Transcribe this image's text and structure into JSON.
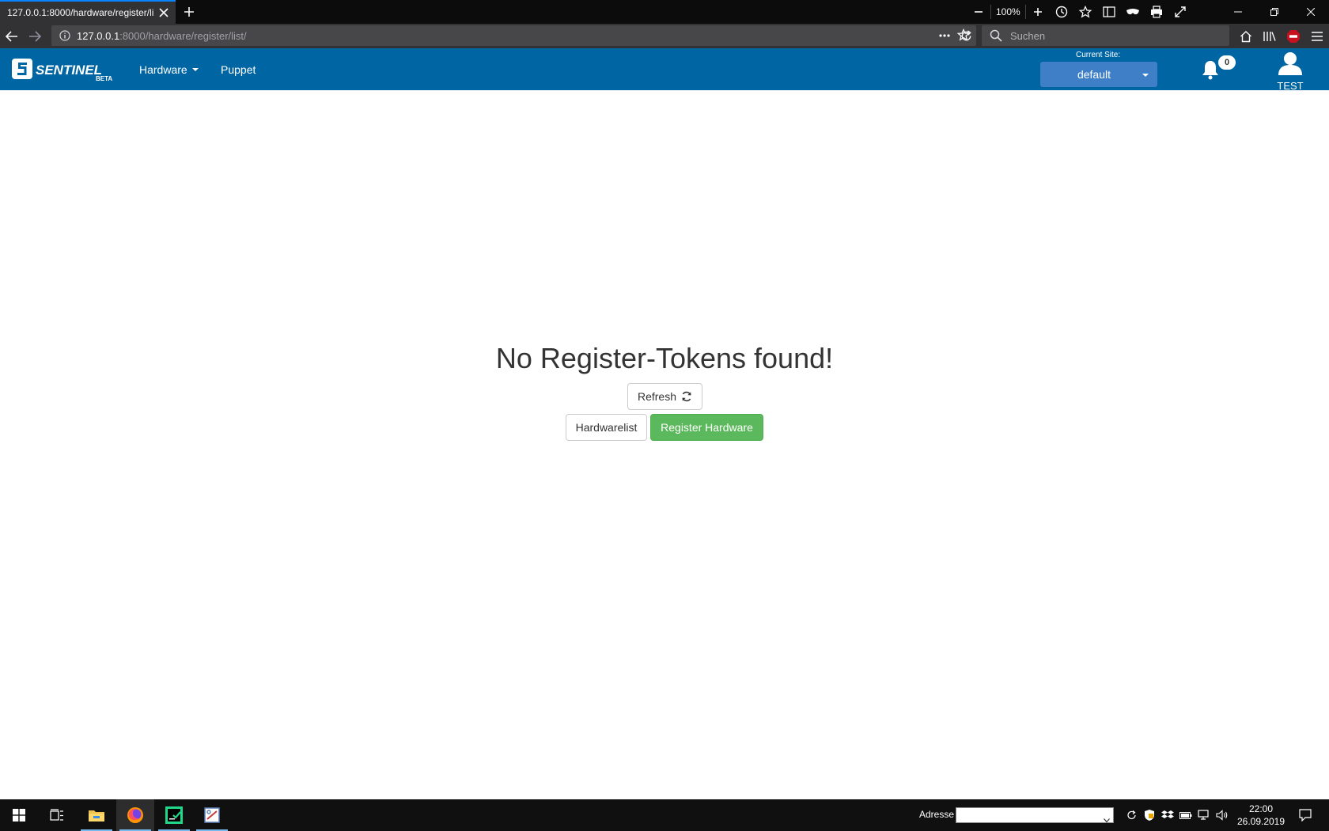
{
  "browser": {
    "tab_title": "127.0.0.1:8000/hardware/register/list/",
    "zoom_level": "100%",
    "url_host": "127.0.0.1",
    "url_path": ":8000/hardware/register/list/",
    "search_placeholder": "Suchen"
  },
  "app": {
    "logo_text": "SENTINEL",
    "logo_sub": "BETA",
    "menu": {
      "hardware": "Hardware",
      "puppet": "Puppet"
    },
    "site_label": "Current Site:",
    "site_value": "default",
    "notification_count": "0",
    "user_name": "TEST",
    "brand_color": "#0065a3"
  },
  "main": {
    "heading": "No Register-Tokens found!",
    "refresh_label": "Refresh",
    "hardwarelist_label": "Hardwarelist",
    "register_label": "Register Hardware"
  },
  "taskbar": {
    "address_label": "Adresse",
    "time": "22:00",
    "date": "26.09.2019"
  }
}
